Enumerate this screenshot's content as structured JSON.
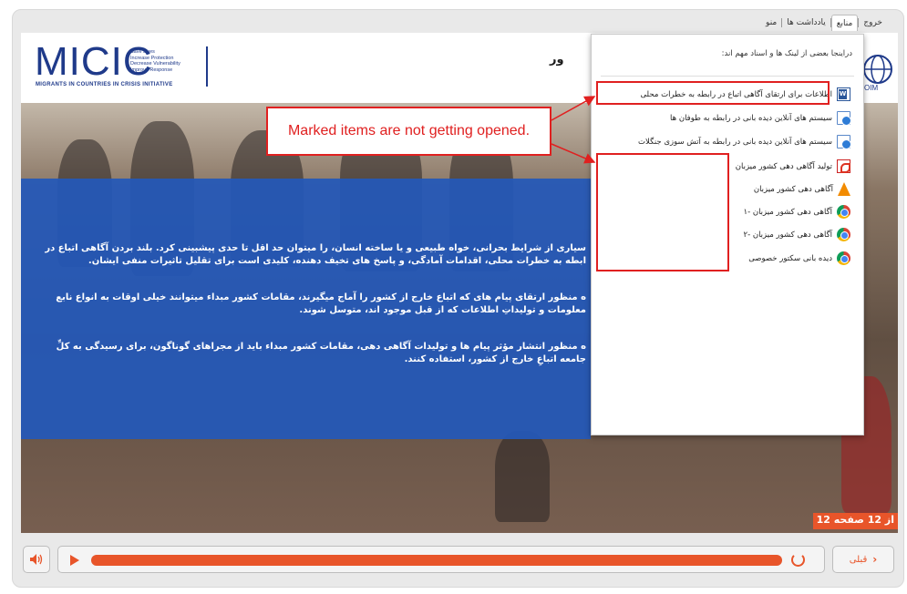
{
  "topnav": {
    "tabs": [
      {
        "label": "خروج",
        "active": false
      },
      {
        "label": "منابع",
        "active": true
      },
      {
        "label": "یادداشت ها",
        "active": false
      },
      {
        "label": "منو",
        "active": false
      }
    ]
  },
  "header": {
    "logo_text": "MICIC",
    "logo_tagline": [
      "Save Lives",
      "Increase Protection",
      "Decrease Vulnerability",
      "Improve Response"
    ],
    "logo_subtitle": "MIGRANTS IN COUNTRIES IN CRISIS INITIATIVE",
    "title_fragment": "ور",
    "iom_label": "OIM"
  },
  "main": {
    "paragraphs": [
      "سیاری از شرایط بحرانی، خواه طبیعی و یا ساخته انسان، را میتوان حد اقل تا حدی پیشبینی کرد. بلند بردن آگاهی اتباع در ابطه به خطرات محلی، اقدامات آمادگی، و پاسخ های تخیف دهنده، کلیدی است برای تقلیل تاثیرات منفی ایشان.",
      "ه منظور ارتقای پیام های که اتباع خارج از کشور را آماج میگیرند، مقامات کشور مبداء میتوانند خیلی اوقات به انواع نابع معلومات و تولیداتِ اطلاعات که از قبل موجود اند، متوسل شوند.",
      "ه منظور انتشار مؤثر پیام ها و تولیدات آگاهی دهی، مقامات کشور مبداء باید از مجراهای گوناگون، برای رسیدگی به کلِّ جامعه اتباعِ خارج از کشور، استفاده کنند."
    ],
    "slide_counter": "12 از 12 صفحه"
  },
  "resources_popup": {
    "intro": "دراینجا بعضی از لینک ها و اسناد مهم اند:",
    "items": [
      {
        "label": "اطلاعات برای ارتقای آگاهی اتباع در رابطه به خطرات محلی",
        "icon": "word-doc-icon"
      },
      {
        "label": "سیستم های آنلاین دیده بانی در رابطه به طوفان ها",
        "icon": "web-link-icon"
      },
      {
        "label": "سیستم های آنلاین دیده بانی در رابطه به آتش سوزی جنگلات",
        "icon": "web-link-icon"
      },
      {
        "label": "تولید آگاهی دهی کشور میزبان",
        "icon": "pdf-icon"
      },
      {
        "label": "آگاهی دهی کشور میزبان",
        "icon": "vlc-media-icon"
      },
      {
        "label": "آگاهی دهی کشور میزبان -۱",
        "icon": "chrome-icon"
      },
      {
        "label": "آگاهی دهی کشور میزبان -۲",
        "icon": "chrome-icon"
      },
      {
        "label": "دیده بانی سکتور خصوصی",
        "icon": "chrome-icon"
      }
    ]
  },
  "annotation": {
    "callout_text": "Marked items are not getting opened.",
    "color": "#e02020"
  },
  "player": {
    "progress_fraction": 1.0,
    "prev_label": "قبلی",
    "accent_color": "#e8552a"
  }
}
